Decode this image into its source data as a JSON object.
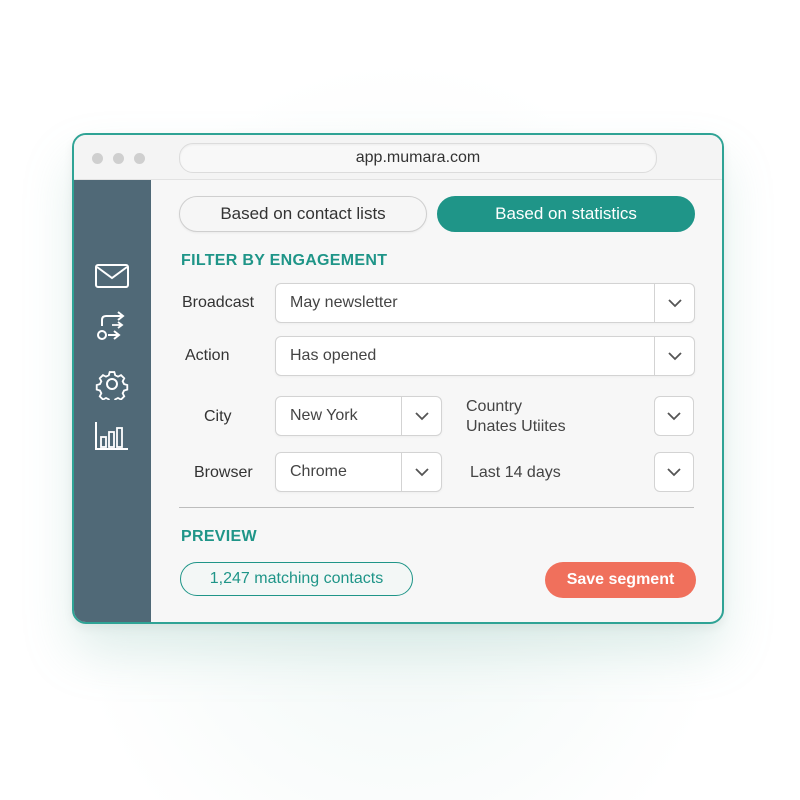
{
  "browser": {
    "url": "app.mumara.com"
  },
  "sidebar": {
    "items": [
      {
        "icon": "envelope-icon"
      },
      {
        "icon": "automation-icon"
      },
      {
        "icon": "gear-icon"
      },
      {
        "icon": "bar-chart-icon"
      }
    ]
  },
  "segment_tabs": {
    "contact_lists_label": "Based on contact lists",
    "statistics_label": "Based on statistics",
    "active": "statistics"
  },
  "filter": {
    "section_title": "FILTER BY ENGAGEMENT",
    "broadcast": {
      "label": "Broadcast",
      "value": "May newsletter"
    },
    "action": {
      "label": "Action",
      "value": "Has opened"
    },
    "city": {
      "label": "City",
      "value": "New York"
    },
    "country": {
      "label": "Country",
      "value": "Unates Utiites"
    },
    "browser": {
      "label": "Browser",
      "value": "Chrome"
    },
    "date_range": {
      "value": "Last 14 days"
    }
  },
  "preview": {
    "section_title": "PREVIEW",
    "matching_text": "1,247 matching contacts",
    "save_label": "Save segment"
  },
  "colors": {
    "accent": "#1f9588",
    "sidebar": "#506977",
    "save": "#f0705c"
  }
}
